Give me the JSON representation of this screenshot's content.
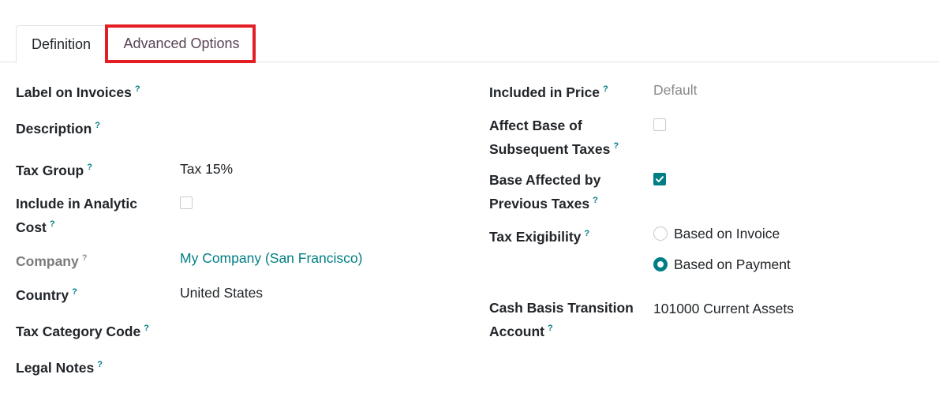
{
  "tabs": {
    "definition": "Definition",
    "advanced": "Advanced Options"
  },
  "left": {
    "label_on_invoices": "Label on Invoices",
    "description": "Description",
    "tax_group": "Tax Group",
    "tax_group_value": "Tax 15%",
    "include_analytic_l1": "Include in Analytic",
    "include_analytic_l2": "Cost",
    "include_analytic_checked": false,
    "company": "Company",
    "company_value": "My Company (San Francisco)",
    "country": "Country",
    "country_value": "United States",
    "tax_category_code": "Tax Category Code",
    "legal_notes": "Legal Notes"
  },
  "right": {
    "included_in_price": "Included in Price",
    "included_in_price_value": "Default",
    "affect_base_l1": "Affect Base of",
    "affect_base_l2": "Subsequent Taxes",
    "affect_base_checked": false,
    "base_affected_l1": "Base Affected by",
    "base_affected_l2": "Previous Taxes",
    "base_affected_checked": true,
    "tax_exigibility": "Tax Exigibility",
    "exigibility_options": [
      "Based on Invoice",
      "Based on Payment"
    ],
    "exigibility_selected": "Based on Payment",
    "cash_basis_l1": "Cash Basis Transition",
    "cash_basis_l2": "Account",
    "cash_basis_value": "101000 Current Assets"
  },
  "help_marker": "?",
  "colors": {
    "accent": "#017e84",
    "highlight": "#e31e24",
    "active_tab_text": "#5a4356"
  }
}
